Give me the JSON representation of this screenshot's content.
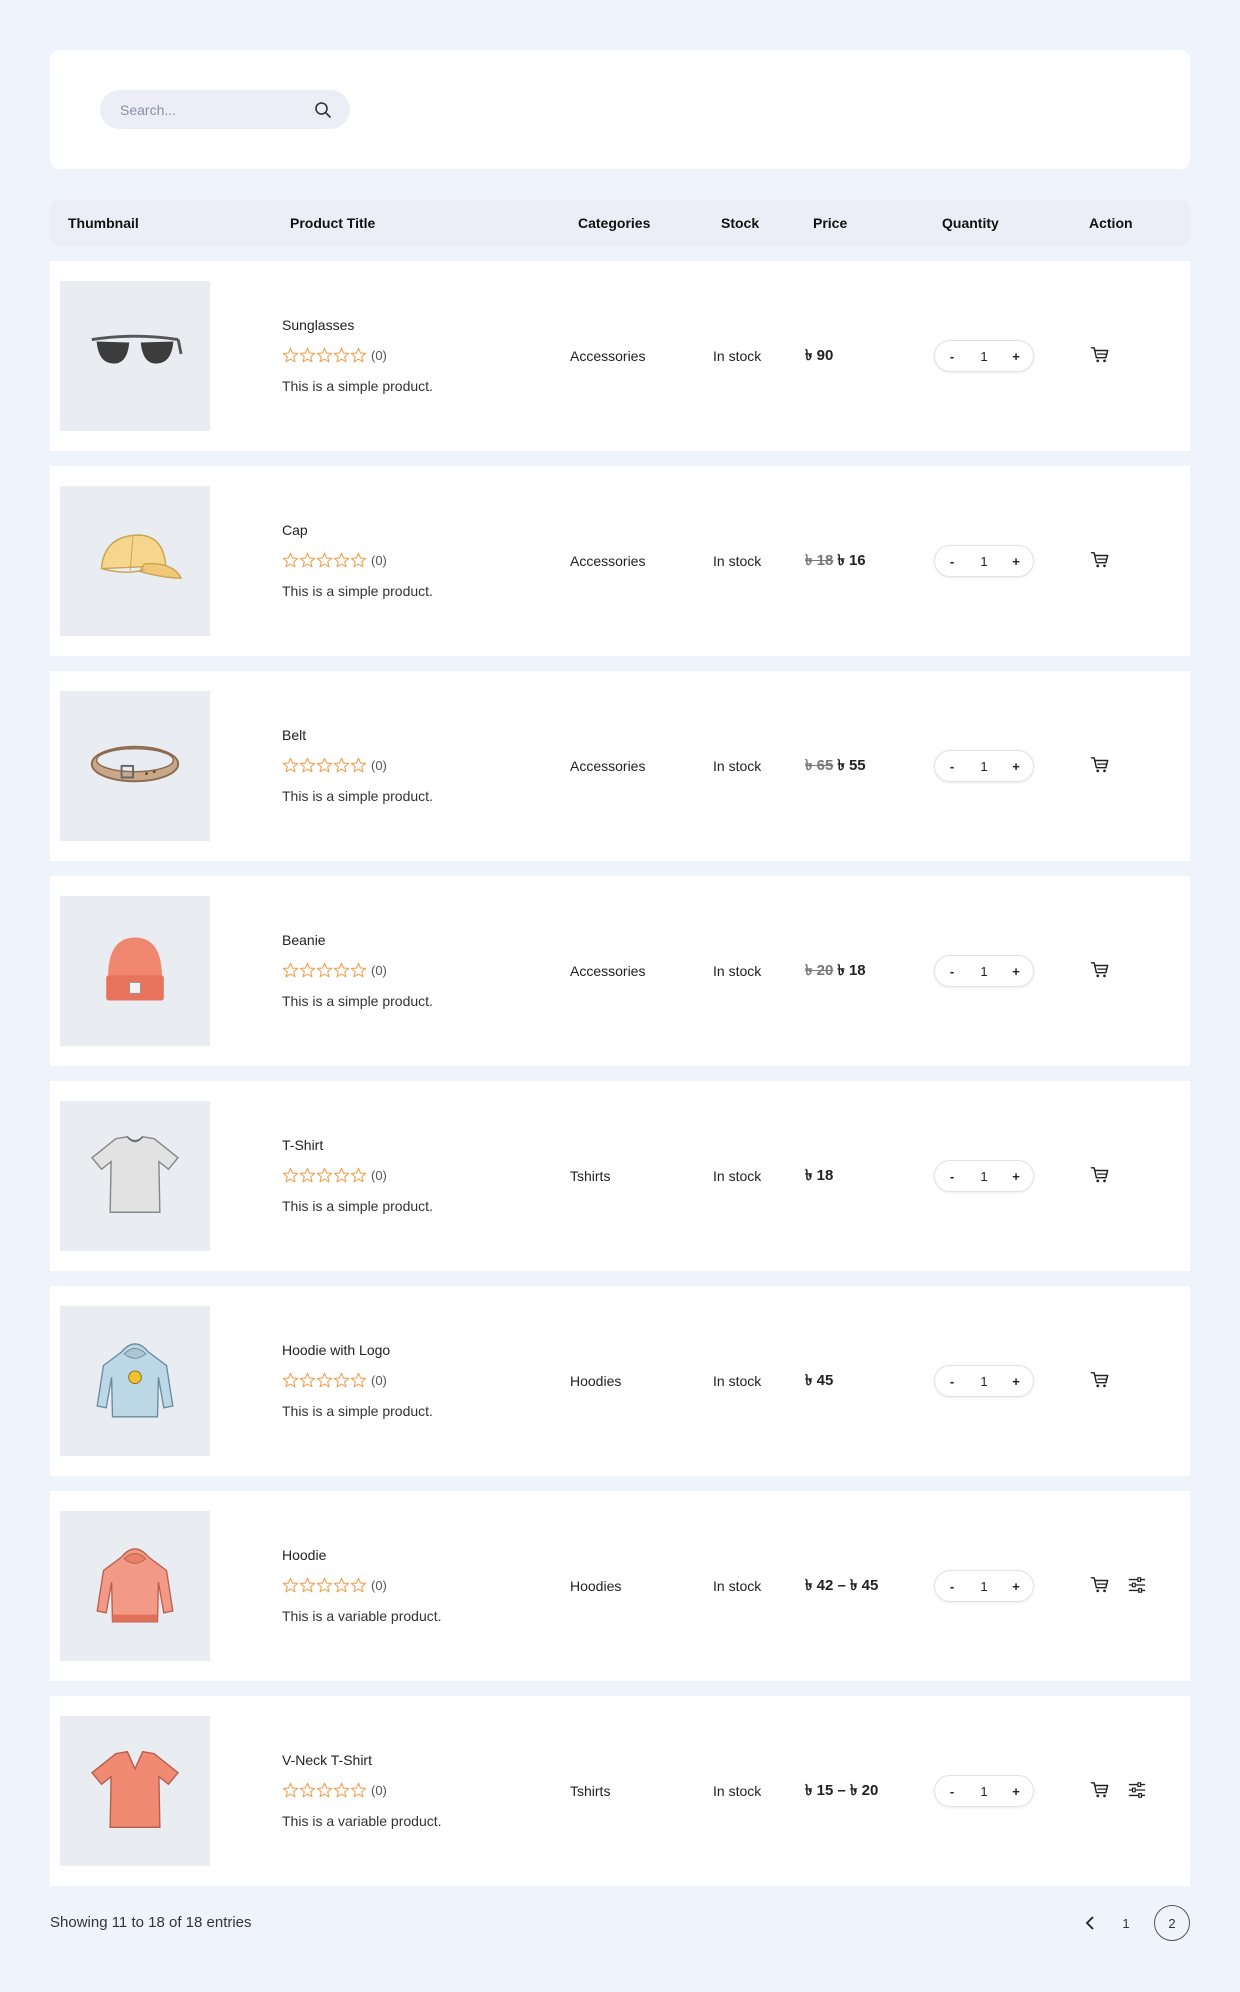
{
  "search": {
    "placeholder": "Search...",
    "icon": "search-icon"
  },
  "headers": {
    "thumbnail": "Thumbnail",
    "title": "Product Title",
    "categories": "Categories",
    "stock": "Stock",
    "price": "Price",
    "quantity": "Quantity",
    "action": "Action"
  },
  "products": [
    {
      "title": "Sunglasses",
      "rating_count": "(0)",
      "desc": "This is a simple product.",
      "category": "Accessories",
      "stock": "In stock",
      "price_old": "",
      "price": "৳ 90",
      "qty": "1",
      "variable": false,
      "thumb_icon": "sunglasses-image"
    },
    {
      "title": "Cap",
      "rating_count": "(0)",
      "desc": "This is a simple product.",
      "category": "Accessories",
      "stock": "In stock",
      "price_old": "৳ 18",
      "price": "৳ 16",
      "qty": "1",
      "variable": false,
      "thumb_icon": "cap-image"
    },
    {
      "title": "Belt",
      "rating_count": "(0)",
      "desc": "This is a simple product.",
      "category": "Accessories",
      "stock": "In stock",
      "price_old": "৳ 65",
      "price": "৳ 55",
      "qty": "1",
      "variable": false,
      "thumb_icon": "belt-image"
    },
    {
      "title": "Beanie",
      "rating_count": "(0)",
      "desc": "This is a simple product.",
      "category": "Accessories",
      "stock": "In stock",
      "price_old": "৳ 20",
      "price": "৳ 18",
      "qty": "1",
      "variable": false,
      "thumb_icon": "beanie-image"
    },
    {
      "title": "T-Shirt",
      "rating_count": "(0)",
      "desc": "This is a simple product.",
      "category": "Tshirts",
      "stock": "In stock",
      "price_old": "",
      "price": "৳ 18",
      "qty": "1",
      "variable": false,
      "thumb_icon": "tshirt-image"
    },
    {
      "title": "Hoodie with Logo",
      "rating_count": "(0)",
      "desc": "This is a simple product.",
      "category": "Hoodies",
      "stock": "In stock",
      "price_old": "",
      "price": "৳ 45",
      "qty": "1",
      "variable": false,
      "thumb_icon": "hoodie-logo-image"
    },
    {
      "title": "Hoodie",
      "rating_count": "(0)",
      "desc": "This is a variable product.",
      "category": "Hoodies",
      "stock": "In stock",
      "price_old": "",
      "price": "৳ 42 – ৳ 45",
      "qty": "1",
      "variable": true,
      "thumb_icon": "hoodie-image"
    },
    {
      "title": "V-Neck T-Shirt",
      "rating_count": "(0)",
      "desc": "This is a variable product.",
      "category": "Tshirts",
      "stock": "In stock",
      "price_old": "",
      "price": "৳ 15 – ৳ 20",
      "qty": "1",
      "variable": true,
      "thumb_icon": "vneck-tshirt-image"
    }
  ],
  "qty_controls": {
    "minus": "-",
    "plus": "+"
  },
  "footer": {
    "showing": "Showing 11 to 18 of 18 entries"
  },
  "pagination": {
    "pages": [
      "1",
      "2"
    ],
    "current": "2"
  },
  "colors": {
    "star": "#f0a050",
    "page_bg": "#eff4fc",
    "header_bg": "#ecedf7",
    "thumb_bg": "#e9edf1"
  }
}
